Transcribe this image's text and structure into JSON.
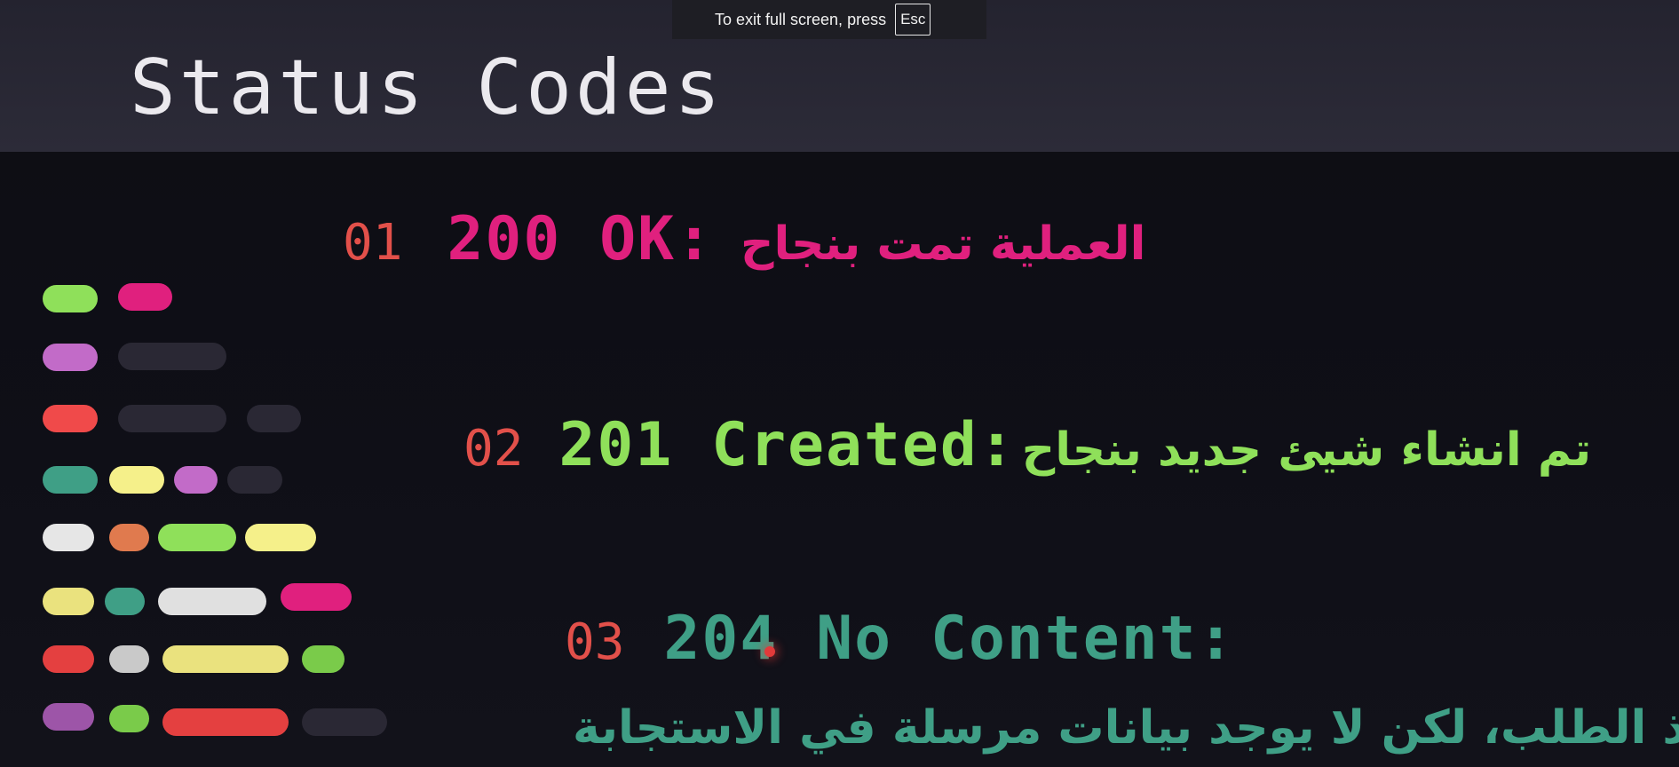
{
  "fullscreen_notice": {
    "text": "To exit full screen, press",
    "key": "Esc"
  },
  "slide": {
    "title": "Status Codes",
    "entries": [
      {
        "number": "01",
        "code": "200 OK:",
        "description": "العملية تمت بنجاح",
        "color": "#e0207e"
      },
      {
        "number": "02",
        "code": "201 Created:",
        "description": "تم انشاء شيئ جديد بنجاح",
        "color": "#8fe05a"
      },
      {
        "number": "03",
        "code": "204 No Content:",
        "description": "تم تنفيذ الطلب، لكن لا يوجد بيانات مرسلة في الاستجابة",
        "color": "#3f9f86"
      }
    ]
  },
  "decoration": {
    "pill_colors": [
      "#8fe05a",
      "#e0207e",
      "#c26bc8",
      "#2a2834",
      "#f04a4a",
      "#3f9f86",
      "#f5f08a",
      "#e6e6e6",
      "#e07a4e",
      "#eae27e",
      "#c9c9c9",
      "#e44040",
      "#9d55a8",
      "#7acb4a"
    ]
  }
}
